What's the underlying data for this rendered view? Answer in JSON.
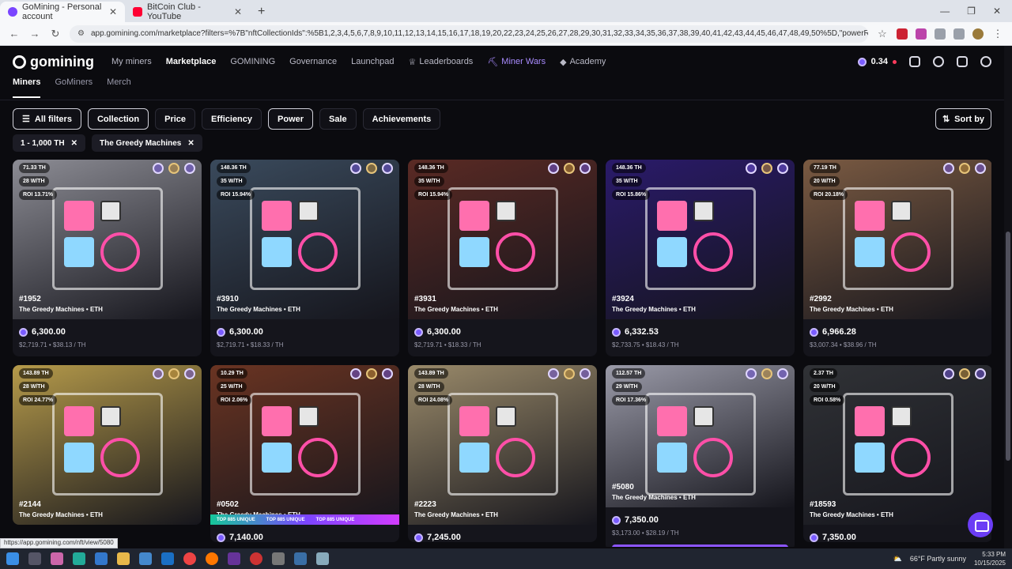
{
  "browser": {
    "tabs": [
      {
        "title": "GoMining - Personal account",
        "active": true,
        "color": "#7a45ff"
      },
      {
        "title": "BitCoin Club - YouTube",
        "active": false,
        "color": "#ff0033"
      }
    ],
    "url": "app.gomining.com/marketplace?filters=%7B\"nftCollectionIds\":%5B1,2,3,4,5,6,7,8,9,10,11,12,13,14,15,16,17,18,19,20,22,23,24,25,26,27,28,29,30,31,32,33,34,35,36,37,38,39,40,41,42,43,44,45,46,47,48,49,50%5D,\"powerRange\":%7B\"min...",
    "status_url": "https://app.gomining.com/nft/view/5080"
  },
  "nav": {
    "logo": "gomining",
    "items": [
      {
        "label": "My miners",
        "state": "normal"
      },
      {
        "label": "Marketplace",
        "state": "active"
      },
      {
        "label": "GOMINING",
        "state": "normal"
      },
      {
        "label": "Governance",
        "state": "normal"
      },
      {
        "label": "Launchpad",
        "state": "normal"
      },
      {
        "label": "Leaderboards",
        "state": "normal"
      },
      {
        "label": "Miner Wars",
        "state": "purple"
      },
      {
        "label": "Academy",
        "state": "normal"
      }
    ],
    "balance": "0.34"
  },
  "subnav": [
    "Miners",
    "GoMiners",
    "Merch"
  ],
  "filters": {
    "all": "All filters",
    "buttons": [
      {
        "label": "Collection",
        "outlined": true
      },
      {
        "label": "Price",
        "outlined": false
      },
      {
        "label": "Efficiency",
        "outlined": false
      },
      {
        "label": "Power",
        "outlined": true
      },
      {
        "label": "Sale",
        "outlined": false
      },
      {
        "label": "Achievements",
        "outlined": false
      }
    ],
    "sort": "Sort by",
    "chips": [
      "1 - 1,000 TH",
      "The Greedy Machines"
    ]
  },
  "cards": [
    {
      "id": "#1952",
      "collection": "The Greedy Machines • ETH",
      "th": "71.33 TH",
      "eff": "28 W/TH",
      "roi": "ROI 13.71%",
      "price": "6,300.00",
      "sub": "$2,719.71 • $38.13 / TH",
      "bg": "#8c8c94",
      "unique": false
    },
    {
      "id": "#3910",
      "collection": "The Greedy Machines • ETH",
      "th": "148.36 TH",
      "eff": "35 W/TH",
      "roi": "ROI 15.94%",
      "price": "6,300.00",
      "sub": "$2,719.71 • $18.33 / TH",
      "bg": "#3a4a5c",
      "unique": false
    },
    {
      "id": "#3931",
      "collection": "The Greedy Machines • ETH",
      "th": "148.36 TH",
      "eff": "35 W/TH",
      "roi": "ROI 15.94%",
      "price": "6,300.00",
      "sub": "$2,719.71 • $18.33 / TH",
      "bg": "#5a2a24",
      "unique": false
    },
    {
      "id": "#3924",
      "collection": "The Greedy Machines • ETH",
      "th": "148.36 TH",
      "eff": "35 W/TH",
      "roi": "ROI 15.86%",
      "price": "6,332.53",
      "sub": "$2,733.75 • $18.43 / TH",
      "bg": "#2a1a6a",
      "unique": false
    },
    {
      "id": "#2992",
      "collection": "The Greedy Machines • ETH",
      "th": "77.19 TH",
      "eff": "20 W/TH",
      "roi": "ROI 20.18%",
      "price": "6,966.28",
      "sub": "$3,007.34 • $38.96 / TH",
      "bg": "#7a5a42",
      "unique": false
    },
    {
      "id": "#2144",
      "collection": "The Greedy Machines • ETH",
      "th": "143.89 TH",
      "eff": "28 W/TH",
      "roi": "ROI 24.77%",
      "price": "",
      "sub": "",
      "bg": "#b59a4a",
      "unique": false
    },
    {
      "id": "#0502",
      "collection": "The Greedy Machines • ETH",
      "th": "10.29 TH",
      "eff": "25 W/TH",
      "roi": "ROI 2.06%",
      "price": "7,140.00",
      "sub": "",
      "bg": "#6a3422",
      "unique": true
    },
    {
      "id": "#2223",
      "collection": "The Greedy Machines • ETH",
      "th": "143.89 TH",
      "eff": "28 W/TH",
      "roi": "ROI 24.08%",
      "price": "7,245.00",
      "sub": "",
      "bg": "#9a8a6a",
      "unique": false
    },
    {
      "id": "#5080",
      "collection": "The Greedy Machines • ETH",
      "th": "112.57 TH",
      "eff": "29 W/TH",
      "roi": "ROI 17.36%",
      "price": "7,350.00",
      "sub": "$3,173.00 • $28.19 / TH",
      "bg": "#9a9aa8",
      "unique": false
    },
    {
      "id": "#18593",
      "collection": "The Greedy Machines • ETH",
      "th": "2.37 TH",
      "eff": "20 W/TH",
      "roi": "ROI 0.58%",
      "price": "7,350.00",
      "sub": "",
      "bg": "#303236",
      "unique": false
    }
  ],
  "unique_label": "TOP 885 UNIQUE",
  "taskbar": {
    "weather": "66°F  Partly sunny",
    "time": "5:33 PM",
    "date": "10/15/2025"
  }
}
